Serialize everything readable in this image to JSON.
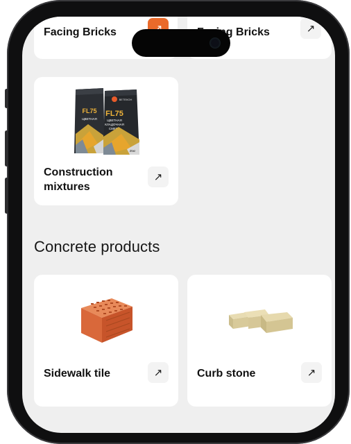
{
  "catalog": {
    "top_cards": [
      {
        "title": "Facing Bricks",
        "arrow": "↗",
        "accent_color": "#ea6a2a"
      },
      {
        "title": "Facing Bricks",
        "arrow": "↗"
      }
    ],
    "mixtures_card": {
      "title": "Construction mixtures",
      "arrow": "↗"
    },
    "section": {
      "title": "Concrete products"
    },
    "product_cards": [
      {
        "title": "Sidewalk tile",
        "arrow": "↗"
      },
      {
        "title": "Curb stone",
        "arrow": "↗"
      }
    ]
  },
  "bag_labels": {
    "brand": "ВЕТЕКОН",
    "code": "FL75",
    "line1": "ЦВЕТНАЯ",
    "line2": "КЛАДОЧНАЯ",
    "line3": "СМЕСЬ",
    "weight": "25кг"
  },
  "colors": {
    "accent": "#ea6a2a",
    "card_bg": "#ffffff",
    "screen_bg": "#efefef"
  }
}
